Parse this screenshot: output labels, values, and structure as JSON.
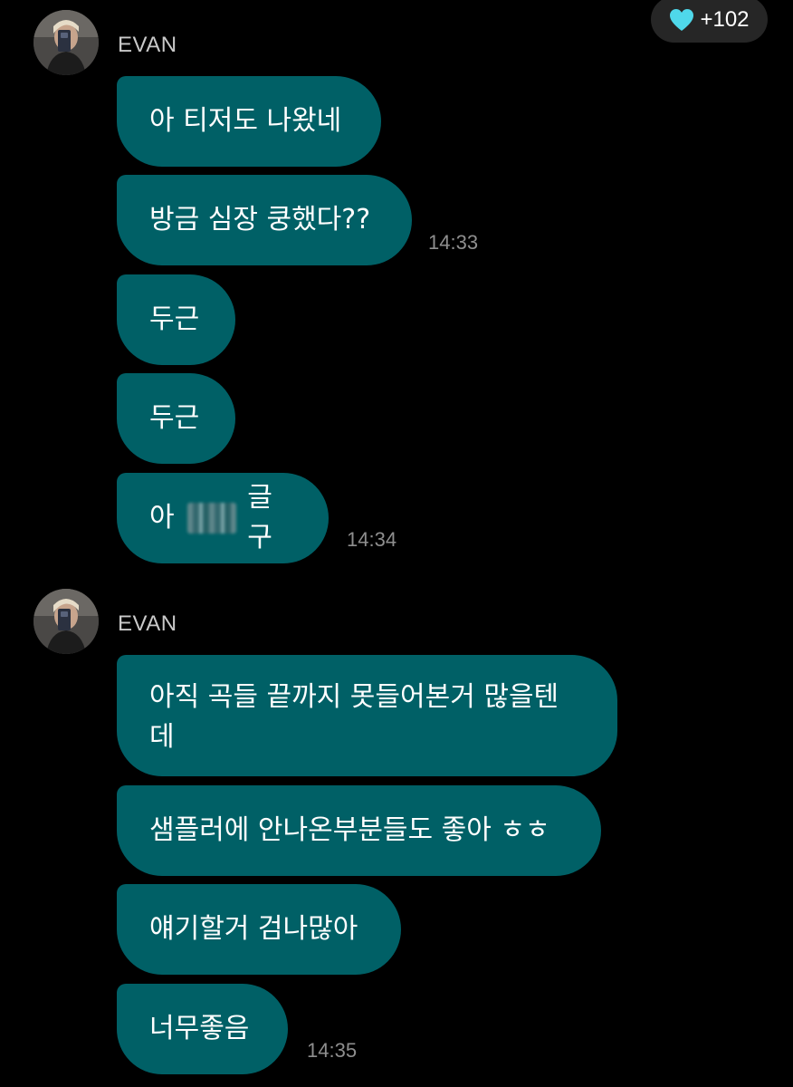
{
  "header": {
    "likes_count": "+102",
    "heart_color": "#4fd8ea"
  },
  "theme": {
    "bubble_color": "#006066",
    "background": "#000000"
  },
  "groups": [
    {
      "sender": "EVAN",
      "messages": [
        {
          "text": "아 티저도 나왔네",
          "time": ""
        },
        {
          "text": "방금 심장 쿵했다??",
          "time": "14:33"
        },
        {
          "text": "두근",
          "time": ""
        },
        {
          "text": "두근",
          "time": ""
        },
        {
          "text_before": "아",
          "text_after": "글구",
          "time": "14:34"
        }
      ]
    },
    {
      "sender": "EVAN",
      "messages": [
        {
          "text": "아직 곡들 끝까지 못들어본거 많을텐\n데",
          "time": ""
        },
        {
          "text": "샘플러에 안나온부분들도 좋아 ㅎㅎ",
          "time": ""
        },
        {
          "text": "얘기할거 검나많아",
          "time": ""
        },
        {
          "text": "너무좋음",
          "time": "14:35"
        }
      ]
    }
  ]
}
